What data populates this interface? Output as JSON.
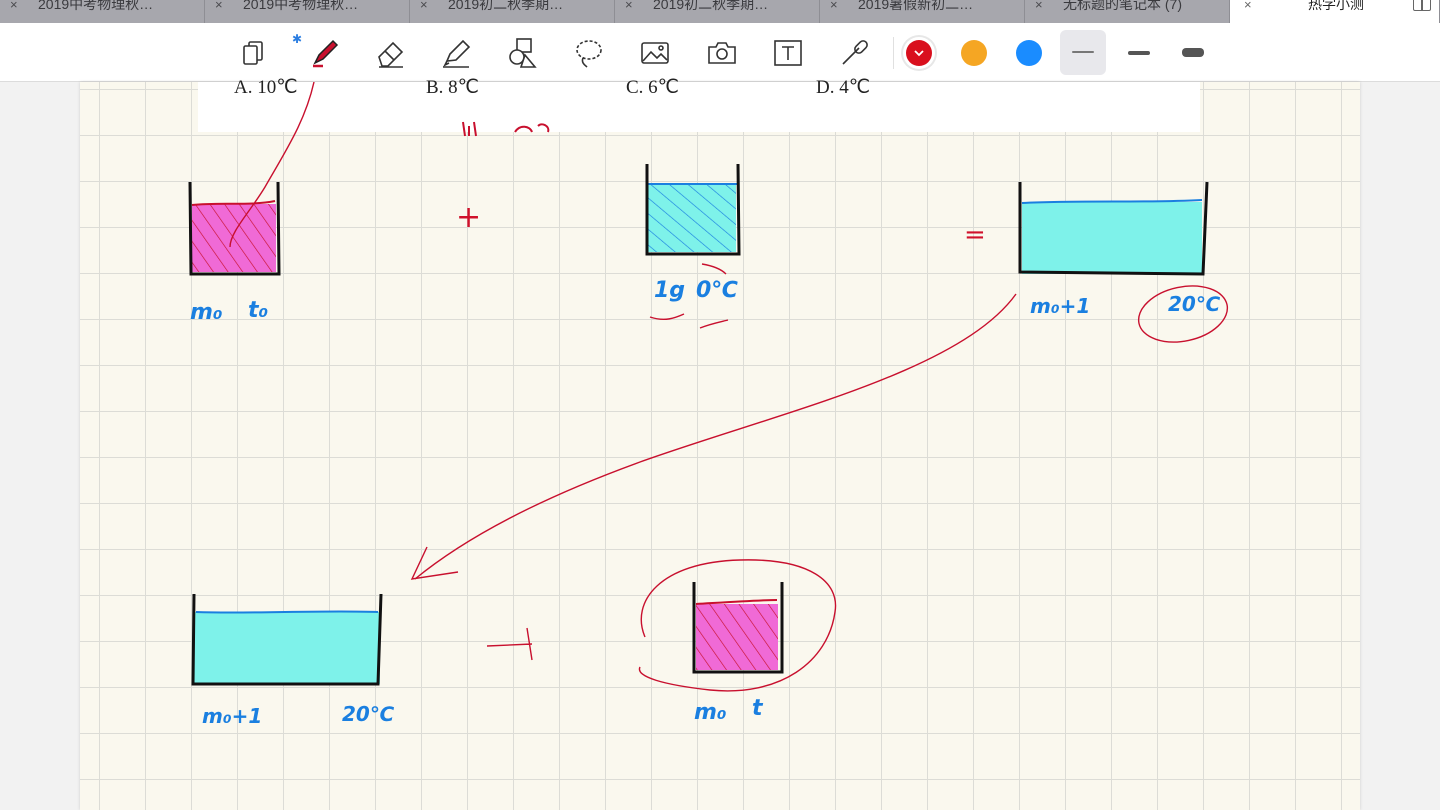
{
  "tabs": [
    {
      "label": "2019中考物理秋…",
      "active": false
    },
    {
      "label": "2019中考物理秋…",
      "active": false
    },
    {
      "label": "2019初二秋季期…",
      "active": false
    },
    {
      "label": "2019初二秋季期…",
      "active": false
    },
    {
      "label": "2019暑假新初二…",
      "active": false
    },
    {
      "label": "无标题的笔记本 (7)",
      "active": false
    },
    {
      "label": "热学小测",
      "active": true
    }
  ],
  "tab_close_glyph": "×",
  "toolbar": {
    "tools": [
      "page-layout-icon",
      "pen-icon",
      "eraser-icon",
      "highlighter-icon",
      "shapes-icon",
      "lasso-icon",
      "image-icon",
      "camera-icon",
      "text-box-icon",
      "laser-pointer-icon"
    ],
    "bluetooth_glyph": "✱",
    "colors": [
      "#d90f1d",
      "#f5a623",
      "#1a8cff"
    ],
    "selected_color": "#d90f1d",
    "widths": [
      "thin",
      "medium",
      "thick"
    ],
    "selected_width": "thin"
  },
  "question": {
    "options": [
      "A. 10℃",
      "B. 8℃",
      "C. 6℃",
      "D. 4℃"
    ]
  },
  "annotations": {
    "beaker1_label": "m₀",
    "beaker1_temp": "t₀",
    "plus1": "+",
    "ice_label": "1g",
    "ice_temp": "0℃",
    "equals": "=",
    "mixture_label": "m₀+1",
    "mixture_temp": "20℃",
    "mixture2_label": "m₀+1",
    "mixture2_temp": "20℃",
    "plus2": "+",
    "beaker4_label": "m₀",
    "beaker4_temp": "t"
  },
  "ink_colors": {
    "pink_fill": "#f06ad6",
    "cyan_fill": "#7ef2ea",
    "blue_line": "#1a7fe0",
    "red_ink": "#c8102e",
    "black_ink": "#111111"
  }
}
